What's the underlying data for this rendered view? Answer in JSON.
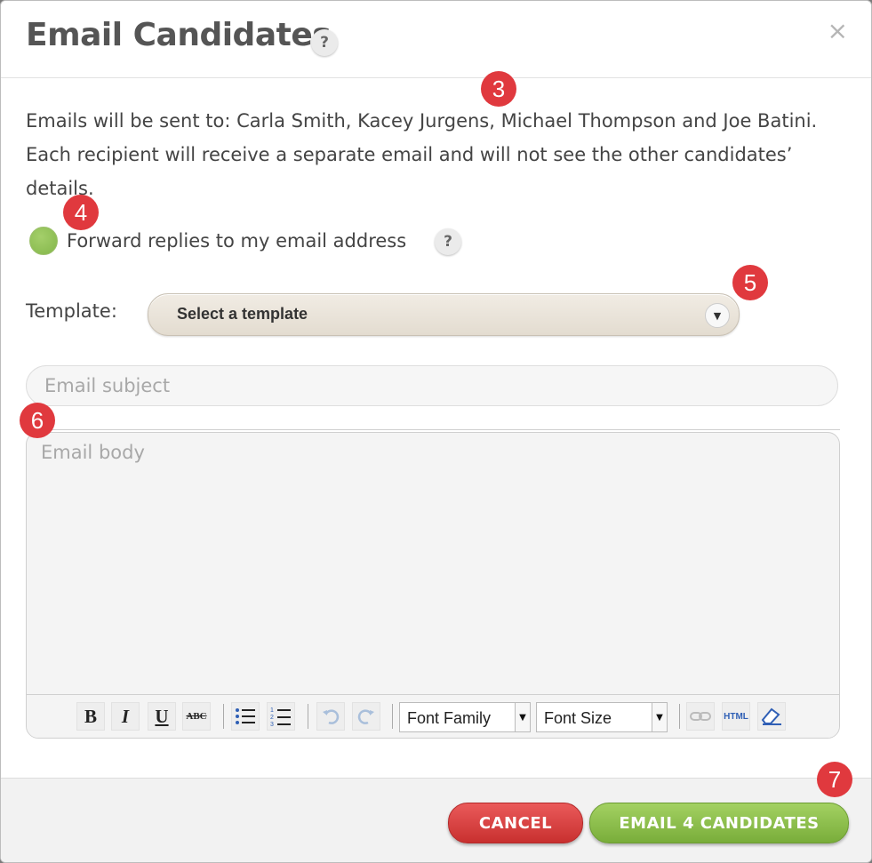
{
  "dialog": {
    "title": "Email Candidates",
    "title_help": "?",
    "close_glyph": "×"
  },
  "markers": [
    "3",
    "4",
    "5",
    "6",
    "7"
  ],
  "recipients_text": "Emails will be sent to: Carla Smith, Kacey Jurgens, Michael Thompson and Joe Batini. Each recipient will receive a separate email and will not see the other candidates’ details.",
  "forward": {
    "label": "Forward replies to my email address",
    "help": "?",
    "checked": true,
    "color": "#8dbd52"
  },
  "template": {
    "label": "Template:",
    "selected": "Select a template"
  },
  "subject": {
    "placeholder": "Email subject",
    "value": ""
  },
  "body": {
    "placeholder": "Email body",
    "value": ""
  },
  "toolbar": {
    "bold": "B",
    "italic": "I",
    "underline": "U",
    "strikethrough": "ABC",
    "font_family": "Font Family",
    "font_size": "Font Size",
    "html": "HTML"
  },
  "footer": {
    "cancel_label": "CANCEL",
    "submit_label": "EMAIL 4 CANDIDATES"
  },
  "colors": {
    "cancel": "#d9403f",
    "submit": "#8cc04e",
    "marker": "#e0393e"
  }
}
